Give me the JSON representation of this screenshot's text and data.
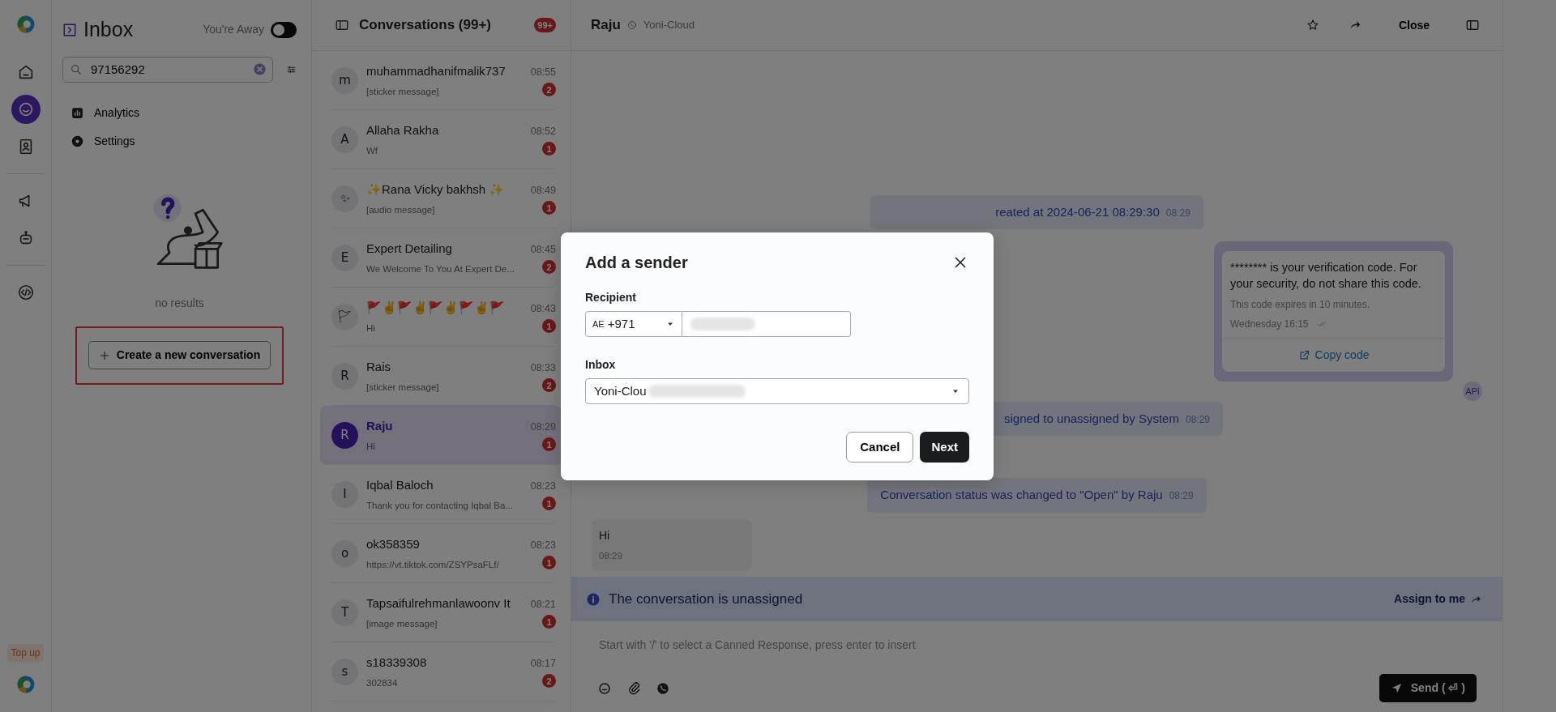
{
  "rail": {
    "groups": [
      {
        "items": [
          {
            "kind": "home",
            "selected": false
          },
          {
            "kind": "chat",
            "selected": true
          },
          {
            "kind": "contacts",
            "selected": false
          }
        ]
      },
      {
        "items": [
          {
            "kind": "campaign",
            "selected": false
          },
          {
            "kind": "bot",
            "selected": false
          }
        ]
      },
      {
        "items": [
          {
            "kind": "code",
            "selected": false
          }
        ]
      }
    ],
    "top_up": "Top up"
  },
  "inbox_panel": {
    "title": "Inbox",
    "away_label": "You're Away",
    "away_toggle": {
      "on": false
    },
    "search": {
      "value": "97156292"
    },
    "menu": [
      {
        "kind": "analytics",
        "label": "Analytics"
      },
      {
        "kind": "settings",
        "label": "Settings"
      }
    ],
    "empty_text": "no results",
    "create_button": {
      "label": "Create a new conversation",
      "highlighted": true
    }
  },
  "conversations": {
    "title": "Conversations (99+)",
    "count_badge": "99+",
    "items": [
      {
        "avatar": "m",
        "name": "muhammadhanifmalik737",
        "preview": "[sticker message]",
        "time": "08:55",
        "unread": "2",
        "selected": false
      },
      {
        "avatar": "A",
        "name": "Allaha Rakha",
        "preview": "Wf",
        "time": "08:52",
        "unread": "1",
        "selected": false
      },
      {
        "avatar": "✨",
        "name": "✨Rana Vicky bakhsh ✨",
        "preview": "[audio message]",
        "time": "08:49",
        "unread": "1",
        "selected": false
      },
      {
        "avatar": "E",
        "name": "Expert Detailing",
        "preview": "We Welcome To You At Expert De...",
        "time": "08:45",
        "unread": "2",
        "selected": false
      },
      {
        "avatar": "🚩",
        "name": "🚩✌🚩✌🚩✌🚩✌🚩",
        "preview": "Hi",
        "time": "08:43",
        "unread": "1",
        "selected": false
      },
      {
        "avatar": "R",
        "name": "Rais",
        "preview": "[sticker message]",
        "time": "08:33",
        "unread": "2",
        "selected": false
      },
      {
        "avatar": "R",
        "name": "Raju",
        "preview": "Hi",
        "time": "08:29",
        "unread": "1",
        "selected": true
      },
      {
        "avatar": "I",
        "name": "Iqbal Baloch",
        "preview": "Thank you for contacting Iqbal Ba...",
        "time": "08:23",
        "unread": "1",
        "selected": false
      },
      {
        "avatar": "o",
        "name": "ok358359",
        "preview": "https://vt.tiktok.com/ZSYPsaFLf/",
        "time": "08:23",
        "unread": "1",
        "selected": false
      },
      {
        "avatar": "T",
        "name": "Tapsaifulrehmanlawoonv It",
        "preview": "[image message]",
        "time": "08:21",
        "unread": "1",
        "selected": false
      },
      {
        "avatar": "s",
        "name": "s18339308",
        "preview": "302834",
        "time": "08:17",
        "unread": "2",
        "selected": false
      }
    ]
  },
  "chat": {
    "contact": "Raju",
    "channel": "Yoni-Cloud",
    "close": "Close",
    "messages": [
      {
        "kind": "activity",
        "text": "reated at 2024-06-21 08:29:30",
        "time": "08:29"
      },
      {
        "kind": "card",
        "text": "******** is your verification code. For your security, do not share this code.",
        "footer": "This code expires in 10 minutes.",
        "time": "Wednesday 16:15",
        "delivered": true,
        "button": "Copy code",
        "sender": "API"
      },
      {
        "kind": "activity",
        "text": "signed to unassigned by System",
        "time": "08:29"
      },
      {
        "kind": "activity",
        "text": "Conversation status was changed to \"Open\" by Raju",
        "time": "08:29"
      },
      {
        "kind": "incoming",
        "text": "Hi",
        "time": "08:29"
      }
    ],
    "banner": {
      "text": "The conversation is unassigned",
      "action": "Assign to me"
    },
    "composer": {
      "placeholder": "Start with '/' to select a Canned Response, press enter to insert",
      "send": "Send ( ⏎ )"
    }
  },
  "modal": {
    "title": "Add a sender",
    "recipient_label": "Recipient",
    "country_code": "AE",
    "dial_code": "+971",
    "inbox_label": "Inbox",
    "inbox_value": "Yoni-Clou",
    "cancel": "Cancel",
    "next": "Next"
  }
}
